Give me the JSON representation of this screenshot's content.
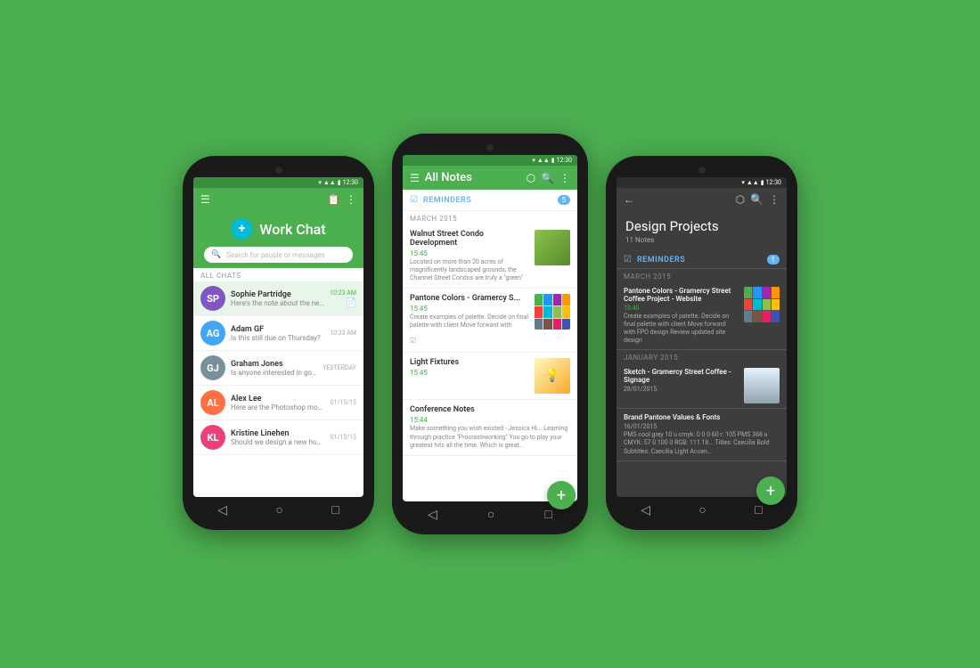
{
  "background": "#4CAF50",
  "phones": {
    "left": {
      "title": "Work Chat",
      "status": "12:30",
      "fab": "+",
      "search": {
        "placeholder": "Search for people or messages"
      },
      "section_label": "ALL CHATS",
      "chats": [
        {
          "name": "Sophie Partridge",
          "preview": "Here's the note about the new office...",
          "time": "10:23 AM",
          "active": true,
          "initials": "SP",
          "avatar_color": "#7E57C2"
        },
        {
          "name": "Adam GF",
          "preview": "Is this still due on Thursday?",
          "time": "10:23 AM",
          "active": false,
          "initials": "AG",
          "avatar_color": "#42A5F5"
        },
        {
          "name": "Graham Jones",
          "preview": "Is anyone interested in going to In-N-Out?",
          "time": "YESTERDAY",
          "active": false,
          "initials": "GJ",
          "avatar_color": "#78909C"
        },
        {
          "name": "Alex Lee",
          "preview": "Here are the Photoshop mockups you ...",
          "time": "01/15/15",
          "active": false,
          "initials": "AL",
          "avatar_color": "#FF7043"
        },
        {
          "name": "Kristine Linehen",
          "preview": "Should we design a new home screen?",
          "time": "01/15/15",
          "active": false,
          "initials": "KL",
          "avatar_color": "#EC407A"
        }
      ],
      "nav": [
        "◁",
        "○",
        "□"
      ]
    },
    "center": {
      "title": "All Notes",
      "status": "12:30",
      "reminders": {
        "label": "REMINDERS",
        "count": "5"
      },
      "month_march": "MARCH 2015",
      "notes": [
        {
          "title": "Walnut Street Condo Development",
          "time": "15:45",
          "body": "Located on more than 20 acres of magnificently landscaped grounds, the Channel Street Condos are truly a \"green\"",
          "thumb_type": "building"
        },
        {
          "title": "Pantone Colors - Gramercy S...",
          "time": "15:45",
          "body": "Create examples of palette. Decide on final palette with client Move forward with",
          "thumb_type": "palette",
          "has_icon": true
        },
        {
          "title": "Light Fixtures",
          "time": "15:45",
          "body": "",
          "thumb_type": "fixture"
        },
        {
          "title": "Conference Notes",
          "time": "15:44",
          "body": "Make something you wish existed - Jessica Hi... Learning through practice \"Procrastiworking\" You go to play your greatest hits all the time. Which is great...",
          "thumb_type": "none"
        }
      ],
      "nav": [
        "◁",
        "○",
        "□"
      ]
    },
    "right": {
      "title": "Design Projects",
      "subtitle": "11 Notes",
      "status": "12:30",
      "reminders": {
        "label": "REMINDERS",
        "count": "1"
      },
      "month_march": "MARCH 2015",
      "month_january": "JANUARY 2015",
      "notes": [
        {
          "title": "Pantone Colors - Gramercy Street Coffee Project - Website",
          "time": "15:45",
          "body": "Create examples of palette. Decide on final palette with client Move forward with FPO design Review updated site design",
          "thumb_type": "palette"
        },
        {
          "title": "Sketch - Gramercy Street Coffee - Signage",
          "time": "28/01/2015",
          "body": "",
          "thumb_type": "bridge"
        },
        {
          "title": "Brand Pantone Values & Fonts",
          "time": "16/01/2015",
          "body": "PMS cool grey 10 u  cmyk: 0 0 0 60  r: 105  PMS 368 u  CMYK: 57 0 100 0  RGB: 111 18... Titles: Caecilia Bold  Subtitles: Caecilia Light  Accen...",
          "thumb_type": "none"
        }
      ],
      "nav": [
        "◁",
        "○",
        "□"
      ]
    }
  }
}
